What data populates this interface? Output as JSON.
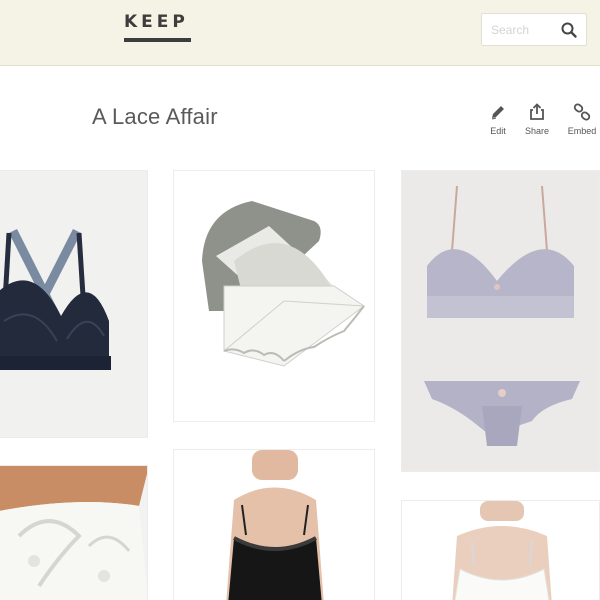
{
  "app": {
    "logo_text": "KEEP"
  },
  "search": {
    "placeholder": "Search",
    "icon": "search-icon"
  },
  "collection": {
    "title": "A Lace Affair"
  },
  "actions": [
    {
      "label": "Edit",
      "icon": "pencil-icon"
    },
    {
      "label": "Share",
      "icon": "share-icon"
    },
    {
      "label": "Embed",
      "icon": "link-icon"
    }
  ],
  "products": [
    {
      "image": "navy strappy lace bralette"
    },
    {
      "image": "white lace envelope stationery"
    },
    {
      "image": "lavender lace bralette and panty set"
    },
    {
      "image": "white lace shorts with bow"
    },
    {
      "image": "black lace camisole"
    },
    {
      "image": "white lace camisole"
    }
  ],
  "colors": {
    "header_bg": "#f5f3e6",
    "logo": "#3d3d3d",
    "title": "#5a5a5a",
    "card_border": "#ececec"
  }
}
